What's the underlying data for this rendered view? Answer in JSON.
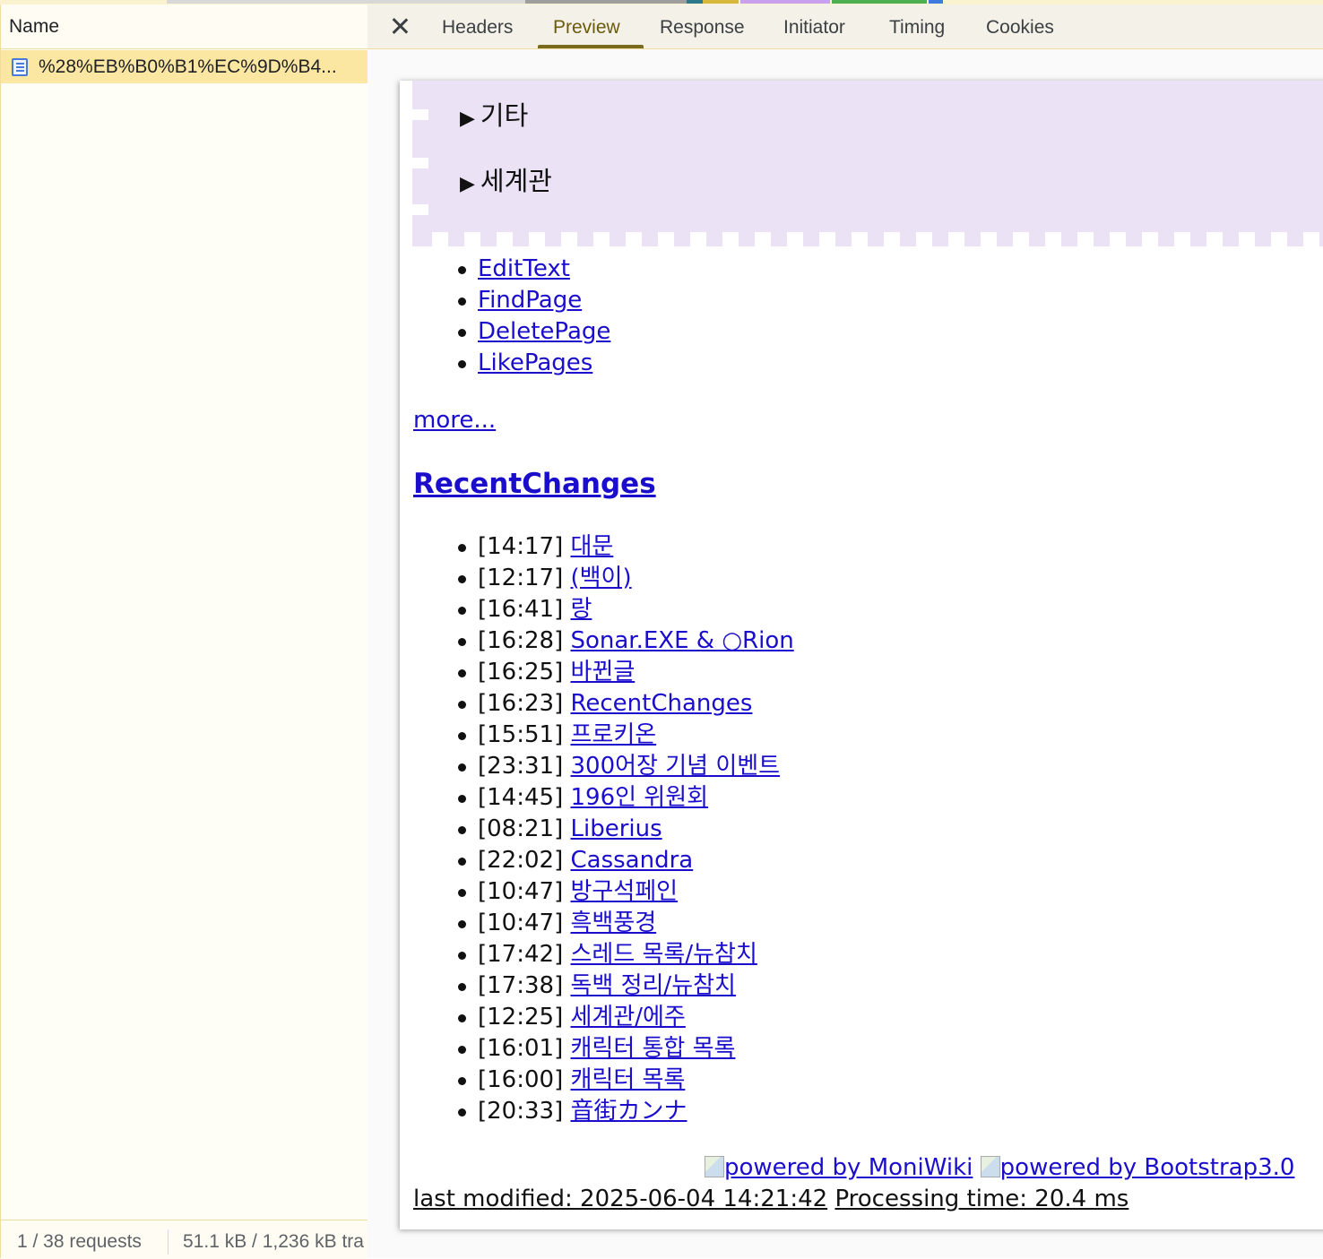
{
  "network": {
    "name_header": "Name",
    "request_name": "%28%EB%B0%B1%EC%9D%B4...",
    "status_requests": "1 / 38 requests",
    "status_transfer": "51.1 kB / 1,236 kB tra"
  },
  "tabs": [
    {
      "label": "Headers"
    },
    {
      "label": "Preview"
    },
    {
      "label": "Response"
    },
    {
      "label": "Initiator"
    },
    {
      "label": "Timing"
    },
    {
      "label": "Cookies"
    }
  ],
  "preview": {
    "folds": [
      {
        "label": "기타"
      },
      {
        "label": "세계관"
      }
    ],
    "fold_triangle": "▶",
    "actions": [
      {
        "label": "EditText"
      },
      {
        "label": "FindPage"
      },
      {
        "label": "DeletePage"
      },
      {
        "label": "LikePages"
      }
    ],
    "more_label": "more...",
    "recent_title": "RecentChanges",
    "recent": [
      {
        "time": "[14:17]",
        "title": "대문"
      },
      {
        "time": "[12:17]",
        "title": "(백이)"
      },
      {
        "time": "[16:41]",
        "title": "랑"
      },
      {
        "time": "[16:28]",
        "title": "Sonar.EXE & ○Rion"
      },
      {
        "time": "[16:25]",
        "title": "바뀐글"
      },
      {
        "time": "[16:23]",
        "title": "RecentChanges"
      },
      {
        "time": "[15:51]",
        "title": "프로키온"
      },
      {
        "time": "[23:31]",
        "title": "300어장 기념 이벤트"
      },
      {
        "time": "[14:45]",
        "title": "196인 위원회"
      },
      {
        "time": "[08:21]",
        "title": "Liberius"
      },
      {
        "time": "[22:02]",
        "title": "Cassandra"
      },
      {
        "time": "[10:47]",
        "title": "방구석페인"
      },
      {
        "time": "[10:47]",
        "title": "흑백풍경"
      },
      {
        "time": "[17:42]",
        "title": "스레드 목록/뉴참치"
      },
      {
        "time": "[17:38]",
        "title": "독백 정리/뉴참치"
      },
      {
        "time": "[12:25]",
        "title": "세계관/에주"
      },
      {
        "time": "[16:01]",
        "title": "캐릭터 통합 목록"
      },
      {
        "time": "[16:00]",
        "title": "캐릭터 목록"
      },
      {
        "time": "[20:33]",
        "title": "音街カンナ"
      }
    ],
    "powered_moniwiki": "powered by MoniWiki",
    "powered_bootstrap": "powered by Bootstrap3.0",
    "last_modified": "last modified: 2025-06-04 14:21:42",
    "processing_time": "Processing time: 20.4 ms"
  }
}
